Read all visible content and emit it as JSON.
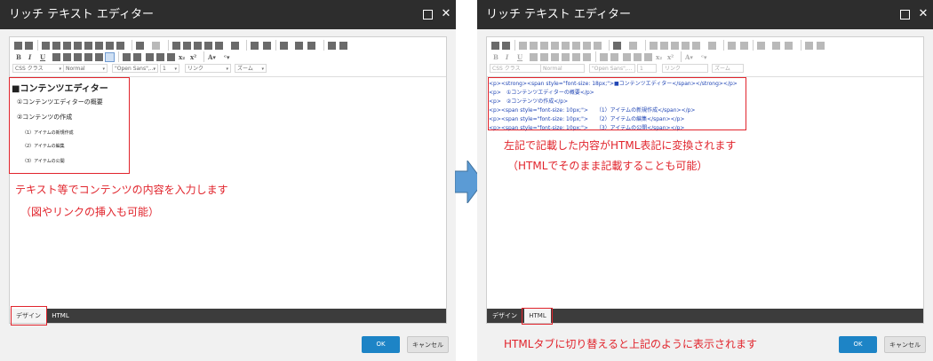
{
  "window": {
    "title": "リッチ テキスト エディター"
  },
  "toolbar": {
    "css_class": "CSS クラス",
    "style_left": "Normal",
    "font_left": "\"Open Sans\",...",
    "size": "1",
    "link": "リンク",
    "zoom": "ズーム",
    "style_right": "Normal",
    "font_right": "\"Open Sans\",..."
  },
  "design_view": {
    "heading": "■コンテンツエディター",
    "items": [
      "①コンテンツエディターの概要",
      "②コンテンツの作成"
    ],
    "subitems": [
      "（1）アイテムの新規作成",
      "（2）アイテムの編集",
      "（3）アイテムの公開"
    ]
  },
  "html_view": {
    "lines": [
      "<p><strong><span style=\"font-size: 18px;\">■コンテンツエディター</span></strong></p>",
      "<p>　①コンテンツエディターの概要</p>",
      "<p>　②コンテンツの作成</p>",
      "<p><span style=\"font-size: 10px;\">　　（1）アイテムの新規作成</span></p>",
      "<p><span style=\"font-size: 10px;\">　　（2）アイテムの編集</span></p>",
      "<p><span style=\"font-size: 10px;\">　　（3）アイテムの公開</span></p>"
    ]
  },
  "tabs": {
    "design": "デザイン",
    "html": "HTML"
  },
  "buttons": {
    "ok": "OK",
    "cancel": "キャンセル"
  },
  "annotations": {
    "left_line1": "テキスト等でコンテンツの内容を入力します",
    "left_line2": "（図やリンクの挿入も可能）",
    "right_line1": "左記で記載した内容がHTML表記に変換されます",
    "right_line2": "（HTMLでそのまま記載することも可能）",
    "right_footer": "HTMLタブに切り替えると上記のように表示されます"
  },
  "colors": {
    "annotation_red": "#e1242c",
    "ok_blue": "#1d84c6",
    "html_code_blue": "#2146b5",
    "titlebar": "#2d2d2d",
    "arrow_blue": "#5b9bd5"
  }
}
